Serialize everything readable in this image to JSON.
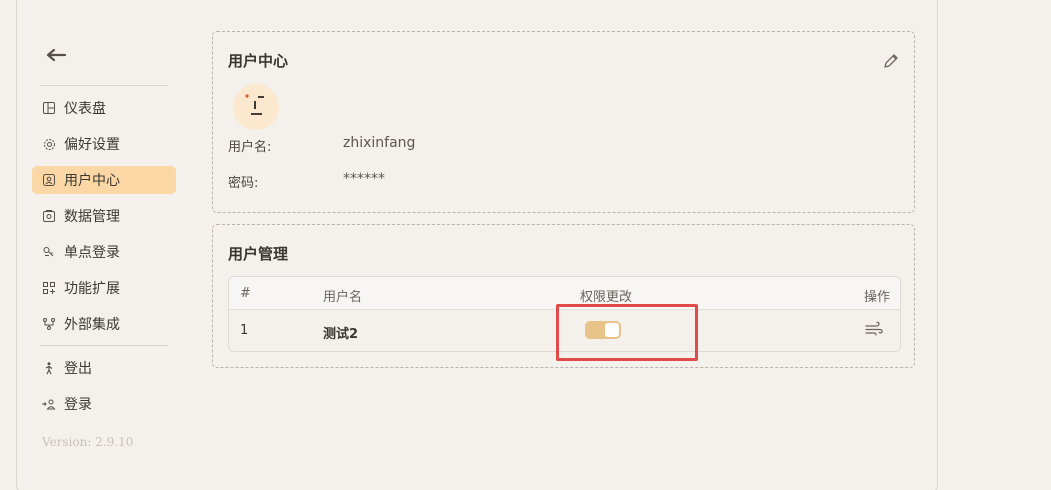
{
  "sidebar": {
    "back_icon": "arrow-left-icon",
    "items": [
      {
        "label": "仪表盘",
        "icon": "dashboard-icon"
      },
      {
        "label": "偏好设置",
        "icon": "gear-icon"
      },
      {
        "label": "用户中心",
        "icon": "user-card-icon",
        "active": true
      },
      {
        "label": "数据管理",
        "icon": "database-icon"
      },
      {
        "label": "单点登录",
        "icon": "key-icon"
      },
      {
        "label": "功能扩展",
        "icon": "grid-icon"
      },
      {
        "label": "外部集成",
        "icon": "integration-icon"
      }
    ],
    "account_items": [
      {
        "label": "登出",
        "icon": "walk-icon"
      },
      {
        "label": "登录",
        "icon": "login-user-icon"
      }
    ],
    "version": "Version: 2.9.10"
  },
  "user_center": {
    "title": "用户中心",
    "username_label": "用户名:",
    "username_value": "zhixinfang",
    "password_label": "密码:",
    "password_value": "******"
  },
  "user_management": {
    "title": "用户管理",
    "columns": [
      "#",
      "用户名",
      "权限更改",
      "操作"
    ],
    "rows": [
      {
        "index": "1",
        "username": "测试2",
        "permission_enabled": true
      }
    ]
  },
  "colors": {
    "accent": "#fbd7a5",
    "toggle_on": "#e8c389",
    "highlight": "#e04a4a"
  }
}
